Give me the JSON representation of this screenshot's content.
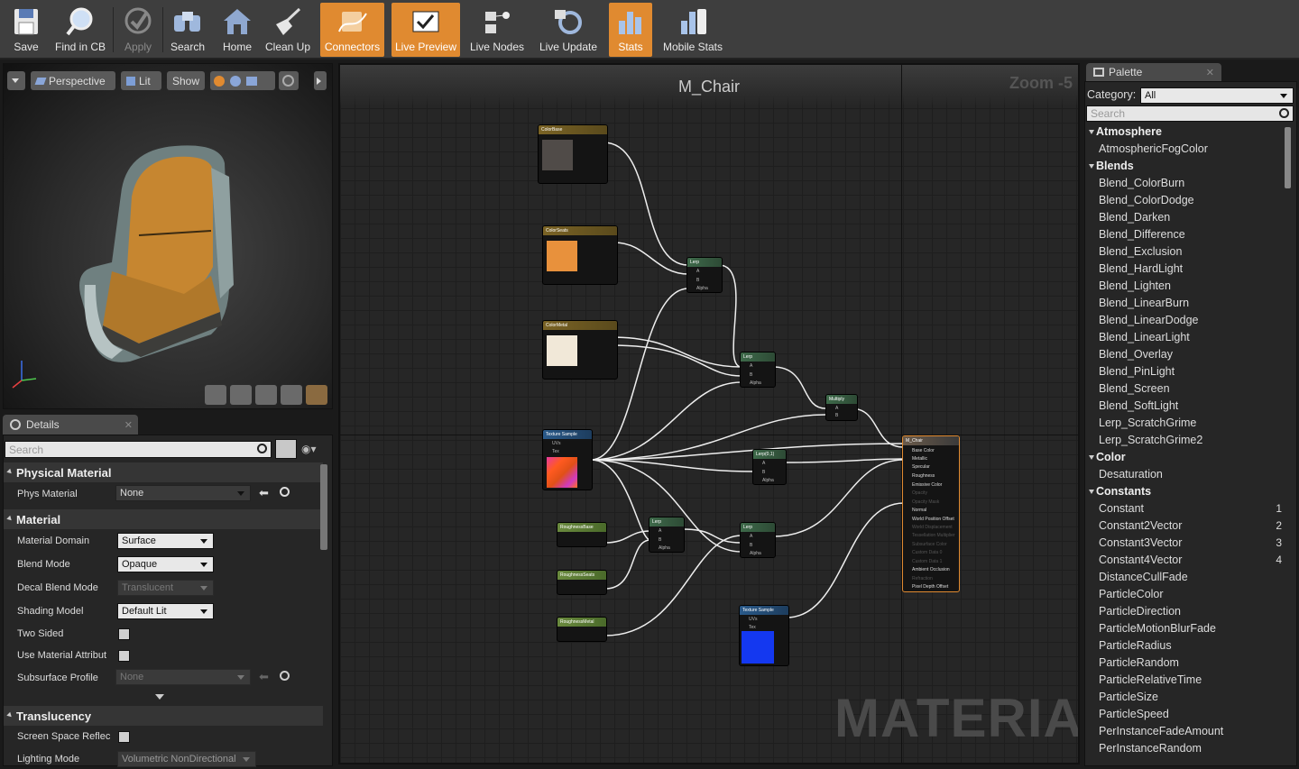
{
  "toolbar": {
    "save": "Save",
    "find": "Find in CB",
    "apply": "Apply",
    "search": "Search",
    "home": "Home",
    "cleanup": "Clean Up",
    "connectors": "Connectors",
    "live_preview": "Live Preview",
    "live_nodes": "Live Nodes",
    "live_update": "Live Update",
    "stats": "Stats",
    "mobile_stats": "Mobile Stats"
  },
  "viewport": {
    "perspective": "Perspective",
    "lit": "Lit",
    "show": "Show"
  },
  "details": {
    "tab": "Details",
    "search_placeholder": "Search",
    "physical_material": "Physical Material",
    "phys_material_label": "Phys Material",
    "phys_material_value": "None",
    "material": "Material",
    "material_domain_label": "Material Domain",
    "material_domain": "Surface",
    "blend_mode_label": "Blend Mode",
    "blend_mode": "Opaque",
    "decal_blend_label": "Decal Blend Mode",
    "decal_blend": "Translucent",
    "shading_model_label": "Shading Model",
    "shading_model": "Default Lit",
    "two_sided_label": "Two Sided",
    "use_material_attr_label": "Use Material Attribut",
    "subsurface_label": "Subsurface Profile",
    "subsurface_value": "None",
    "translucency": "Translucency",
    "ssr_label": "Screen Space Reflec",
    "lighting_mode_label": "Lighting Mode",
    "lighting_mode": "Volumetric NonDirectional"
  },
  "graph": {
    "title": "M_Chair",
    "zoom": "Zoom -5",
    "watermark": "MATERIAL",
    "nodes": {
      "colorbase": "ColorBase",
      "colorseats": "ColorSeats",
      "colormetal": "ColorMetal",
      "texsample": "Texture Sample",
      "lerp1": "Lerp",
      "lerp2": "Lerp",
      "multiply": "Multiply",
      "lerp01": "Lerp(0,1)",
      "rbase": "RoughnessBase",
      "rseats": "RoughnessSeats",
      "rmetal": "RoughnessMetal",
      "lerp3": "Lerp",
      "lerp4": "Lerp",
      "texsample2": "Texture Sample",
      "mchair": "M_Chair"
    },
    "pins": {
      "a": "A",
      "b": "B",
      "alpha": "Alpha",
      "uvs": "UVs",
      "tex": "Tex"
    },
    "result_pins": [
      "Base Color",
      "Metallic",
      "Specular",
      "Roughness",
      "Emissive Color",
      "Opacity",
      "Opacity Mask",
      "Normal",
      "World Position Offset",
      "World Displacement",
      "Tessellation Multiplier",
      "Subsurface Color",
      "Custom Data 0",
      "Custom Data 1",
      "Ambient Occlusion",
      "Refraction",
      "Pixel Depth Offset"
    ]
  },
  "palette": {
    "tab": "Palette",
    "category_label": "Category:",
    "category_value": "All",
    "search_placeholder": "Search",
    "sections": [
      {
        "name": "Atmosphere",
        "items": [
          {
            "label": "AtmosphericFogColor"
          }
        ]
      },
      {
        "name": "Blends",
        "items": [
          {
            "label": "Blend_ColorBurn"
          },
          {
            "label": "Blend_ColorDodge"
          },
          {
            "label": "Blend_Darken"
          },
          {
            "label": "Blend_Difference"
          },
          {
            "label": "Blend_Exclusion"
          },
          {
            "label": "Blend_HardLight"
          },
          {
            "label": "Blend_Lighten"
          },
          {
            "label": "Blend_LinearBurn"
          },
          {
            "label": "Blend_LinearDodge"
          },
          {
            "label": "Blend_LinearLight"
          },
          {
            "label": "Blend_Overlay"
          },
          {
            "label": "Blend_PinLight"
          },
          {
            "label": "Blend_Screen"
          },
          {
            "label": "Blend_SoftLight"
          },
          {
            "label": "Lerp_ScratchGrime"
          },
          {
            "label": "Lerp_ScratchGrime2"
          }
        ]
      },
      {
        "name": "Color",
        "items": [
          {
            "label": "Desaturation"
          }
        ]
      },
      {
        "name": "Constants",
        "items": [
          {
            "label": "Constant",
            "key": "1"
          },
          {
            "label": "Constant2Vector",
            "key": "2"
          },
          {
            "label": "Constant3Vector",
            "key": "3"
          },
          {
            "label": "Constant4Vector",
            "key": "4"
          },
          {
            "label": "DistanceCullFade"
          },
          {
            "label": "ParticleColor"
          },
          {
            "label": "ParticleDirection"
          },
          {
            "label": "ParticleMotionBlurFade"
          },
          {
            "label": "ParticleRadius"
          },
          {
            "label": "ParticleRandom"
          },
          {
            "label": "ParticleRelativeTime"
          },
          {
            "label": "ParticleSize"
          },
          {
            "label": "ParticleSpeed"
          },
          {
            "label": "PerInstanceFadeAmount"
          },
          {
            "label": "PerInstanceRandom"
          }
        ]
      }
    ]
  },
  "colors": {
    "accent": "#e08a30",
    "seats": "#e8913c",
    "metal": "#f1e8d8",
    "base": "#504b48"
  }
}
